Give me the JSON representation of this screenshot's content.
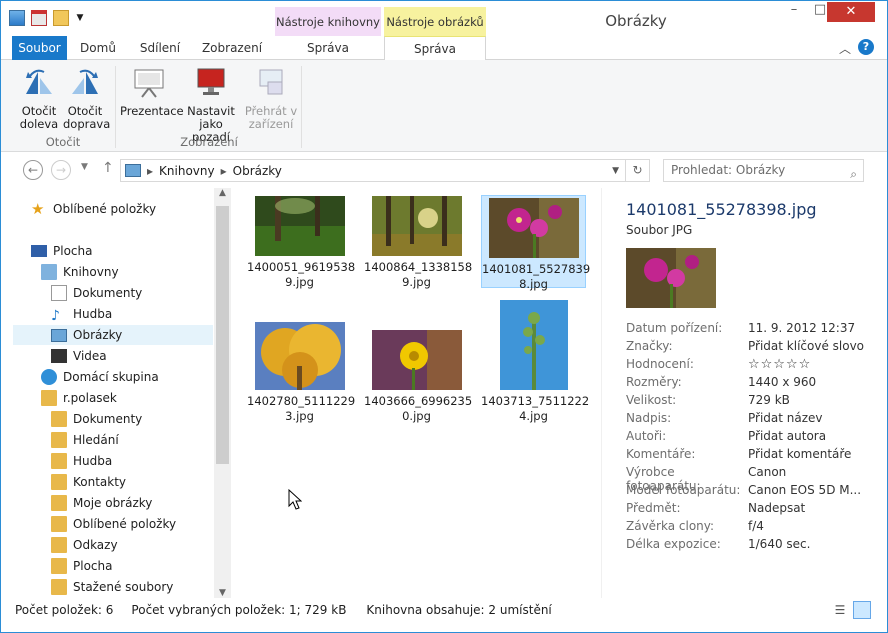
{
  "window": {
    "title": "Obrázky",
    "context_tabs": [
      "Nástroje knihovny",
      "Nástroje obrázků"
    ],
    "controls": {
      "minimize": "–",
      "maximize": "□",
      "close": "✕"
    }
  },
  "ribbon_tabs": [
    "Soubor",
    "Domů",
    "Sdílení",
    "Zobrazení",
    "Správa",
    "Správa"
  ],
  "ribbon": {
    "rotate_left": "Otočit doleva",
    "rotate_right": "Otočit doprava",
    "group_rotate": "Otočit",
    "slideshow": "Prezentace",
    "set_background": "Nastavit jako pozadí",
    "cast": "Přehrát v zařízení",
    "group_view": "Zobrazení"
  },
  "address": {
    "crumbs": [
      "Knihovny",
      "Obrázky"
    ],
    "search_placeholder": "Prohledat: Obrázky"
  },
  "nav_pane": {
    "favorites": "Oblíbené položky",
    "desktop": "Plocha",
    "libraries": "Knihovny",
    "lib_items": [
      "Dokumenty",
      "Hudba",
      "Obrázky",
      "Videa"
    ],
    "homegroup": "Domácí skupina",
    "user": "r.polasek",
    "user_items": [
      "Dokumenty",
      "Hledání",
      "Hudba",
      "Kontakty",
      "Moje obrázky",
      "Oblíbené položky",
      "Odkazy",
      "Plocha",
      "Stažené soubory"
    ]
  },
  "files": [
    {
      "name": "1400051_96195389.jpg",
      "line1": "1400051_9619538",
      "line2": "9.jpg"
    },
    {
      "name": "1400864_13381589.jpg",
      "line1": "1400864_1338158",
      "line2": "9.jpg"
    },
    {
      "name": "1401081_55278398.jpg",
      "line1": "1401081_5527839",
      "line2": "8.jpg"
    },
    {
      "name": "1402780_51112293.jpg",
      "line1": "1402780_5111229",
      "line2": "3.jpg"
    },
    {
      "name": "1403666_69962350.jpg",
      "line1": "1403666_6996235",
      "line2": "0.jpg"
    },
    {
      "name": "1403713_75112224.jpg",
      "line1": "1403713_7511222",
      "line2": "4.jpg"
    }
  ],
  "details": {
    "filename": "1401081_55278398.jpg",
    "type": "Soubor JPG",
    "rows": [
      {
        "k": "Datum pořízení:",
        "v": "11. 9. 2012 12:37"
      },
      {
        "k": "Značky:",
        "v": "Přidat klíčové slovo"
      },
      {
        "k": "Hodnocení:",
        "v": "☆☆☆☆☆"
      },
      {
        "k": "Rozměry:",
        "v": "1440 x 960"
      },
      {
        "k": "Velikost:",
        "v": "729 kB"
      },
      {
        "k": "Nadpis:",
        "v": "Přidat název"
      },
      {
        "k": "Autoři:",
        "v": "Přidat autora"
      },
      {
        "k": "Komentáře:",
        "v": "Přidat komentáře"
      },
      {
        "k": "Výrobce fotoaparátu:",
        "v": "Canon"
      },
      {
        "k": "Model fotoaparátu:",
        "v": "Canon EOS 5D M..."
      },
      {
        "k": "Předmět:",
        "v": "Nadepsat"
      },
      {
        "k": "Závěrka clony:",
        "v": "f/4"
      },
      {
        "k": "Délka expozice:",
        "v": "1/640 sec."
      }
    ]
  },
  "status": {
    "count": "Počet položek: 6",
    "selected": "Počet vybraných položek: 1; 729 kB",
    "locations": "Knihovna obsahuje: 2 umístění"
  }
}
